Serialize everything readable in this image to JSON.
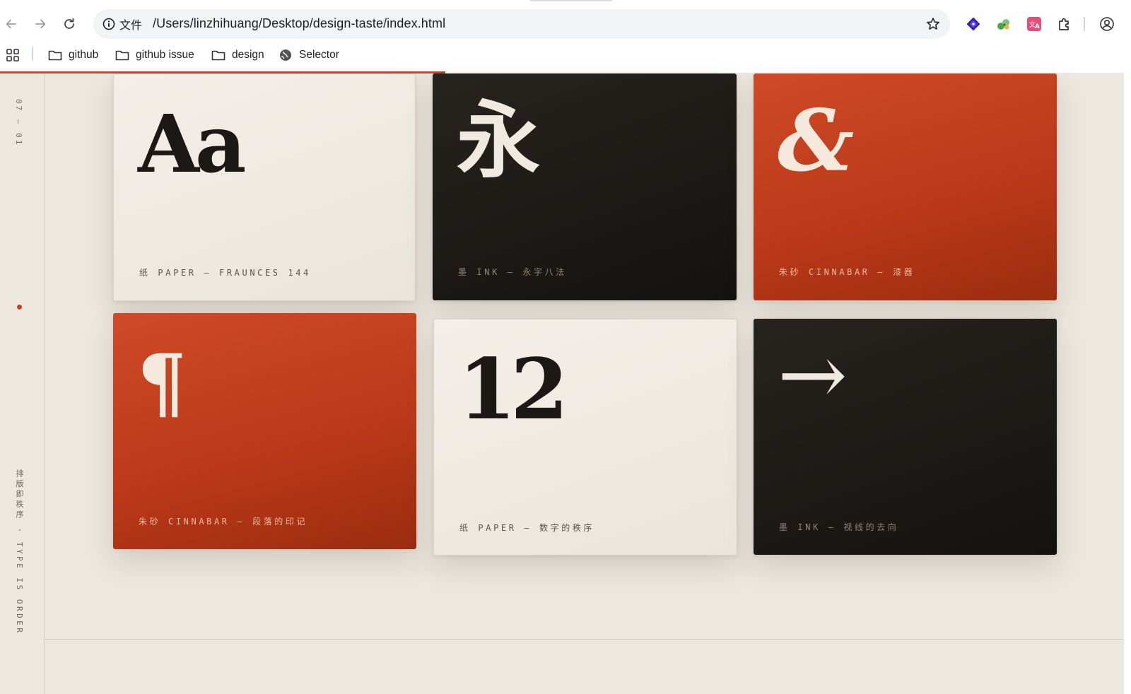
{
  "browser": {
    "address_info_label": "文件",
    "url": "/Users/linzhihuang/Desktop/design-taste/index.html",
    "bookmarks": [
      {
        "label": "github",
        "icon": "folder-icon"
      },
      {
        "label": "github issue",
        "icon": "folder-icon"
      },
      {
        "label": "design",
        "icon": "folder-icon"
      },
      {
        "label": "Selector",
        "icon": "globe-icon"
      }
    ],
    "colors": {
      "accent_progress": "#c44a2a"
    }
  },
  "rail": {
    "page_index": "07 — 01",
    "tagline": "排版即秩序 · TYPE IS ORDER"
  },
  "cards": [
    {
      "theme": "paper",
      "glyph": "Aa",
      "caption": "纸 PAPER — FRAUNCES 144"
    },
    {
      "theme": "ink",
      "glyph": "永",
      "caption": "墨 INK — 永字八法"
    },
    {
      "theme": "cinnabar",
      "glyph": "&",
      "caption": "朱砂 CINNABAR — 漆器"
    },
    {
      "theme": "cinnabar",
      "glyph": "¶",
      "caption": "朱砂 CINNABAR — 段落的印记"
    },
    {
      "theme": "paper",
      "glyph": "12",
      "caption": "纸 PAPER — 数字的秩序"
    },
    {
      "theme": "ink",
      "glyph": "→",
      "caption": "墨 INK — 视线的去向"
    }
  ],
  "colors": {
    "paper": "#efeae2",
    "ink": "#1c1916",
    "cinnabar": "#c4411f"
  }
}
